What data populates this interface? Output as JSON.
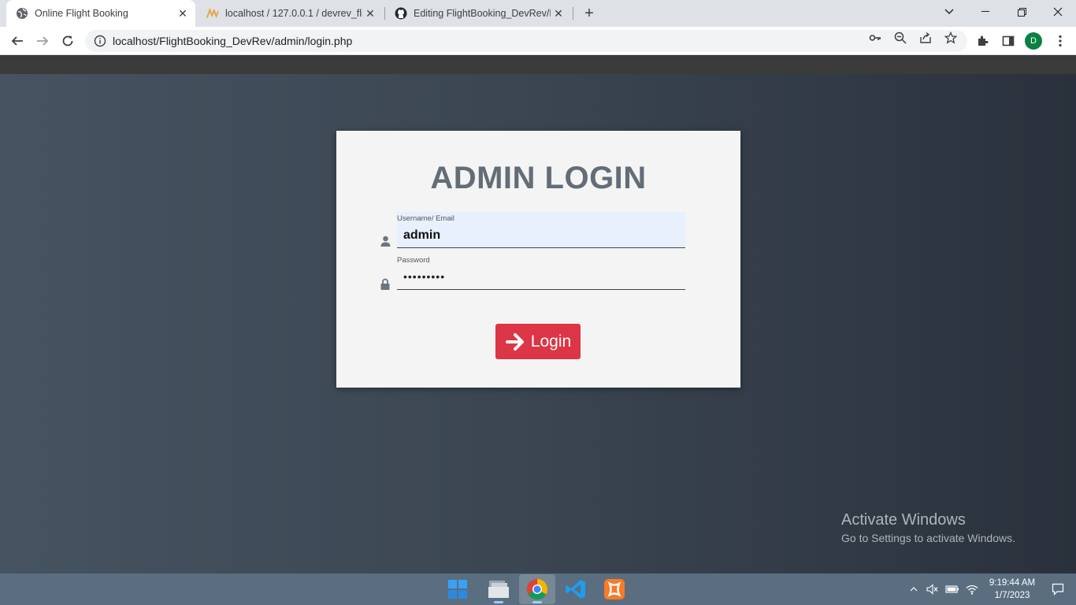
{
  "browser": {
    "tabs": [
      {
        "title": "Online Flight Booking",
        "icon": "globe-icon",
        "active": true
      },
      {
        "title": "localhost / 127.0.0.1 / devrev_flig",
        "icon": "phpmyadmin-icon",
        "active": false
      },
      {
        "title": "Editing FlightBooking_DevRev/RE",
        "icon": "github-icon",
        "active": false
      }
    ],
    "url": "localhost/FlightBooking_DevRev/admin/login.php",
    "profile_initial": "D"
  },
  "login": {
    "title": "ADMIN LOGIN",
    "username_label": "Username/ Email",
    "username_value": "admin",
    "password_label": "Password",
    "password_value": "•••••••••",
    "button_label": "Login",
    "button_color": "#dc3545"
  },
  "watermark": {
    "line1": "Activate Windows",
    "line2": "Go to Settings to activate Windows."
  },
  "taskbar": {
    "time": "9:19:44 AM",
    "date": "1/7/2023"
  }
}
